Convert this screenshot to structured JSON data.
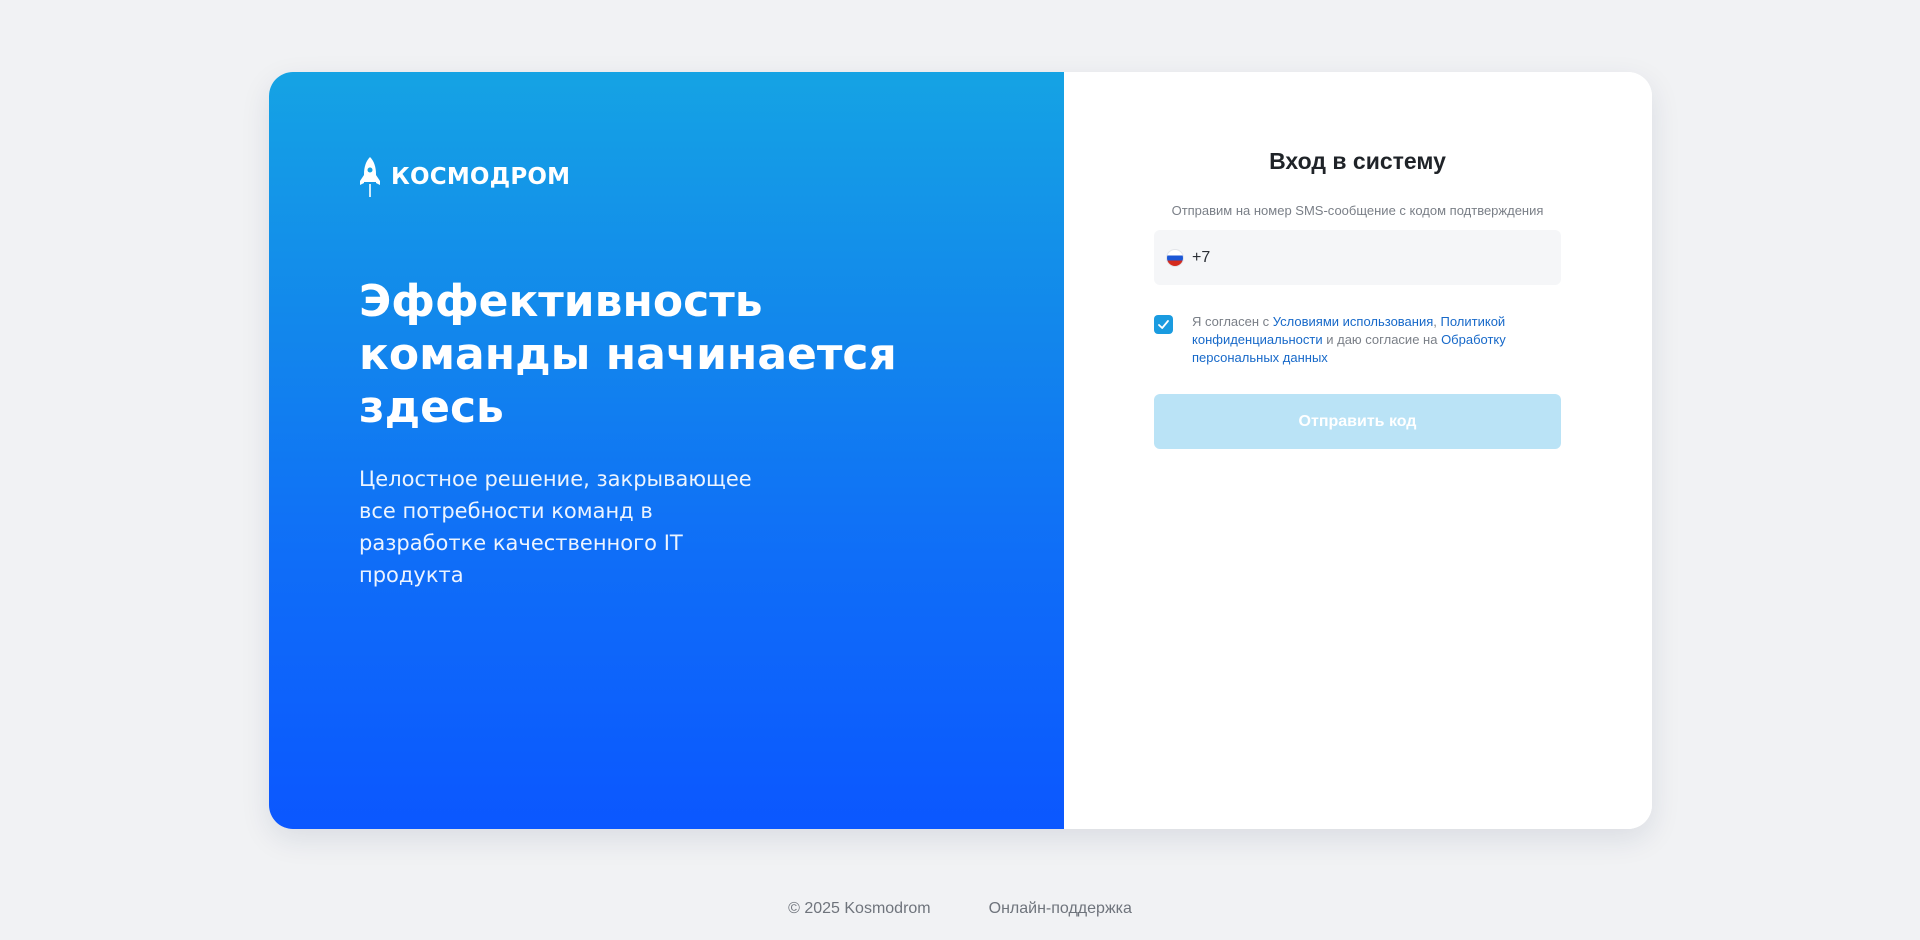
{
  "brand": {
    "name": "КОСМОДРОМ",
    "icon": "rocket-icon"
  },
  "hero": {
    "title": "Эффективность команды начинается здесь",
    "subtitle": "Целостное решение, закрывающее все потребности команд в разработке качественного IT продукта"
  },
  "login": {
    "title": "Вход в систему",
    "hint": "Отправим на номер SMS-сообщение с кодом подтверждения",
    "phone": {
      "country_icon": "russia-flag-icon",
      "value": "+7"
    },
    "consent": {
      "checked": true,
      "text_1": "Я согласен с ",
      "link_terms": "Условиями использования",
      "text_2": ", ",
      "link_privacy": "Политикой конфиденциальности",
      "text_3": " и даю согласие на ",
      "link_personal": "Обработку персональных данных"
    },
    "submit_label": "Отправить код"
  },
  "footer": {
    "copyright": "© 2025 Kosmodrom",
    "support_link": "Онлайн-поддержка"
  },
  "colors": {
    "gradient_top": "#15a3e4",
    "gradient_bottom": "#0b57ff",
    "accent": "#1a9be0",
    "link": "#1769c9",
    "button_disabled": "#bae3f6",
    "background": "#f1f2f4"
  }
}
